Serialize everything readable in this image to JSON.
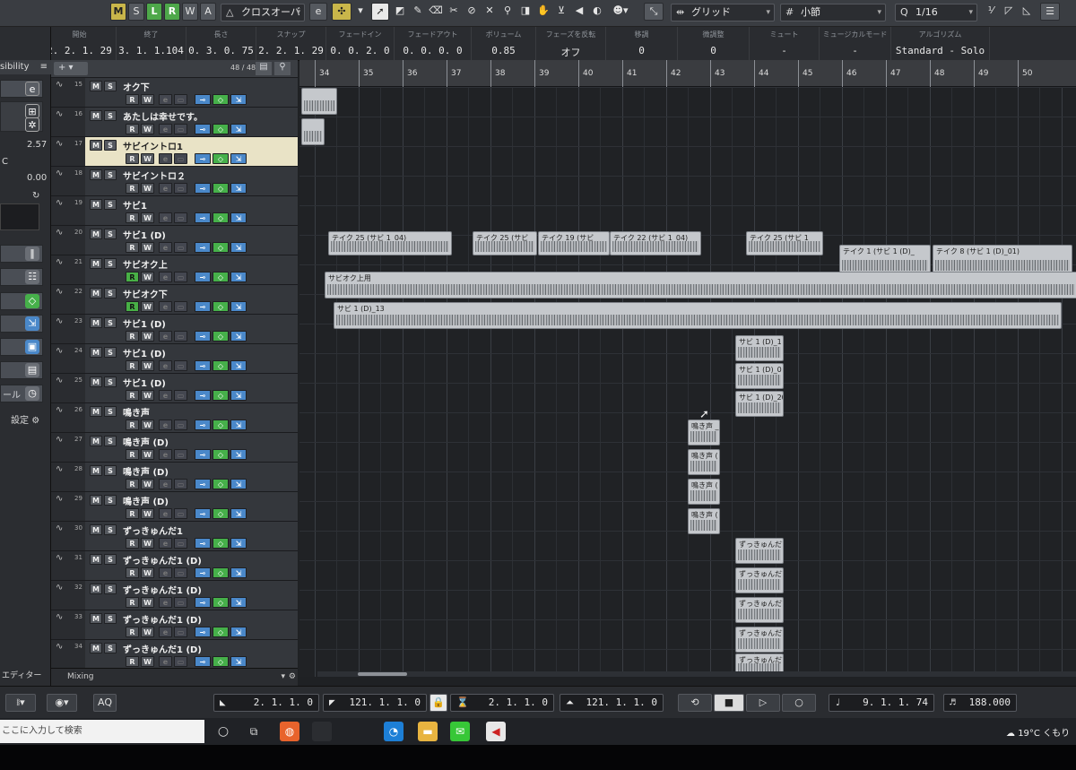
{
  "toolbar": {
    "mode_buttons": [
      "M",
      "S",
      "L",
      "R",
      "W",
      "A"
    ],
    "crossfade_label": "クロスオーバー",
    "grid_label": "グリッド",
    "bar_label": "小節",
    "quantize_value": "1/16",
    "quantize_icon": "Q"
  },
  "info": {
    "fields": [
      {
        "label": "開始",
        "value": "2. 2. 1. 29"
      },
      {
        "label": "終了",
        "value": "3. 1. 1.104"
      },
      {
        "label": "長さ",
        "value": "0. 3. 0. 75"
      },
      {
        "label": "スナップ",
        "value": "2. 2. 1. 29"
      },
      {
        "label": "フェードイン",
        "value": "0. 0. 2. 0"
      },
      {
        "label": "フェードアウト",
        "value": "0. 0. 0. 0"
      },
      {
        "label": "ボリューム",
        "value": "0.85"
      },
      {
        "label": "フェーズを反転",
        "value": "オフ"
      },
      {
        "label": "移調",
        "value": "0"
      },
      {
        "label": "微調整",
        "value": "0"
      },
      {
        "label": "ミュート",
        "value": "-"
      },
      {
        "label": "ミュージカルモード",
        "value": "-"
      },
      {
        "label": "アルゴリズム",
        "value": "Standard - Solo"
      }
    ]
  },
  "inspector": {
    "visibility": "sibility",
    "value_top": "2.57",
    "value_c": "C",
    "value_zero": "0.00",
    "label_tool": "ール",
    "settings": "設定",
    "editor": "エディター"
  },
  "tracklist": {
    "count": "48 / 48",
    "footer_label": "Mixing",
    "tracks": [
      {
        "num": "15",
        "name": "オク下"
      },
      {
        "num": "16",
        "name": "あたしは幸せです。"
      },
      {
        "num": "17",
        "name": "サビイントロ1"
      },
      {
        "num": "18",
        "name": "サビイントロ２"
      },
      {
        "num": "19",
        "name": "サビ1"
      },
      {
        "num": "20",
        "name": "サビ1 (D)"
      },
      {
        "num": "21",
        "name": "サビオク上"
      },
      {
        "num": "22",
        "name": "サビオク下"
      },
      {
        "num": "23",
        "name": "サビ1 (D)"
      },
      {
        "num": "24",
        "name": "サビ1 (D)"
      },
      {
        "num": "25",
        "name": "サビ1 (D)"
      },
      {
        "num": "26",
        "name": "鳴き声"
      },
      {
        "num": "27",
        "name": "鳴き声 (D)"
      },
      {
        "num": "28",
        "name": "鳴き声 (D)"
      },
      {
        "num": "29",
        "name": "鳴き声 (D)"
      },
      {
        "num": "30",
        "name": "ずっきゅんだ1"
      },
      {
        "num": "31",
        "name": "ずっきゅんだ1 (D)"
      },
      {
        "num": "32",
        "name": "ずっきゅんだ1 (D)"
      },
      {
        "num": "33",
        "name": "ずっきゅんだ1 (D)"
      },
      {
        "num": "34",
        "name": "ずっきゅんだ1 (D)"
      }
    ]
  },
  "ruler": {
    "bars": [
      "34",
      "35",
      "36",
      "37",
      "38",
      "39",
      "40",
      "41",
      "42",
      "43",
      "44",
      "45",
      "46",
      "47",
      "48",
      "49",
      "50"
    ]
  },
  "clips": [
    {
      "name": "テイク 25 (サビ 1_04)"
    },
    {
      "name": "テイク 25 (サビ"
    },
    {
      "name": "テイク 19 (サビ"
    },
    {
      "name": "テイク 22 (サビ 1_04)"
    },
    {
      "name": "テイク 25 (サビ 1"
    },
    {
      "name": "テイク 1 (サビ 1 (D)_"
    },
    {
      "name": "テイク 8 (サビ 1 (D)_01)"
    },
    {
      "name": "サビオク上用"
    },
    {
      "name": "サビ 1 (D)_13"
    },
    {
      "name": "サビ 1 (D)_1"
    },
    {
      "name": "サビ 1 (D)_0"
    },
    {
      "name": "サビ 1 (D)_20"
    },
    {
      "name": "鳴き声 _("
    },
    {
      "name": "鳴き声 ("
    },
    {
      "name": "鳴き声 ("
    },
    {
      "name": "鳴き声 ("
    },
    {
      "name": "ずっきゅんだ1_"
    },
    {
      "name": "ずっきゅんだ1 ("
    },
    {
      "name": "ずっきゅんだ1 ("
    },
    {
      "name": "ずっきゅんだ1 ("
    },
    {
      "name": "ずっきゅんだ1 ("
    }
  ],
  "transport": {
    "left_locator": "2. 1. 1. 0",
    "right_locator": "121. 1. 1. 0",
    "punch_in": "2. 1. 1. 0",
    "punch_out": "121. 1. 1. 0",
    "position": "9. 1. 1. 74",
    "tempo": "188.000",
    "aq": "AQ"
  },
  "taskbar": {
    "search_placeholder": "ここに入力して検索",
    "weather": "19°C くもり"
  }
}
